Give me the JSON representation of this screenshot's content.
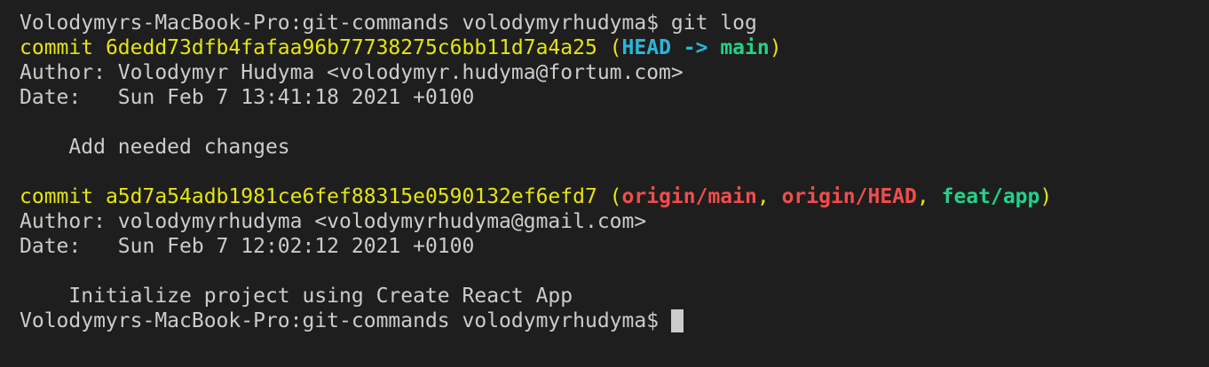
{
  "prompt": {
    "text": "Volodymyrs-MacBook-Pro:git-commands volodymyrhudyma$ ",
    "command": "git log"
  },
  "commits": [
    {
      "prefix": "commit ",
      "hash": "6dedd73dfb4fafaa96b77738275c6bb11d7a4a25",
      "open_paren": " (",
      "head": "HEAD",
      "arrow": " -> ",
      "branch": "main",
      "close_paren": ")",
      "author_line": "Author: Volodymyr Hudyma <volodymyr.hudyma@fortum.com>",
      "date_line": "Date:   Sun Feb 7 13:41:18 2021 +0100",
      "message": "    Add needed changes"
    },
    {
      "prefix": "commit ",
      "hash": "a5d7a54adb1981ce6fef88315e0590132ef6efd7",
      "open_paren": " (",
      "ref1": "origin/main",
      "sep1": ", ",
      "ref2": "origin/HEAD",
      "sep2": ", ",
      "ref3": "feat/app",
      "close_paren": ")",
      "author_line": "Author: volodymyrhudyma <volodymyrhudyma@gmail.com>",
      "date_line": "Date:   Sun Feb 7 12:02:12 2021 +0100",
      "message": "    Initialize project using Create React App"
    }
  ],
  "final_prompt": {
    "text": "Volodymyrs-MacBook-Pro:git-commands volodymyrhudyma$ "
  },
  "colors": {
    "background": "#1e1e1e",
    "text": "#cccccc",
    "hash": "#e5e510",
    "head": "#29b8db",
    "local_branch": "#23d18b",
    "remote_branch": "#f14c4c"
  }
}
